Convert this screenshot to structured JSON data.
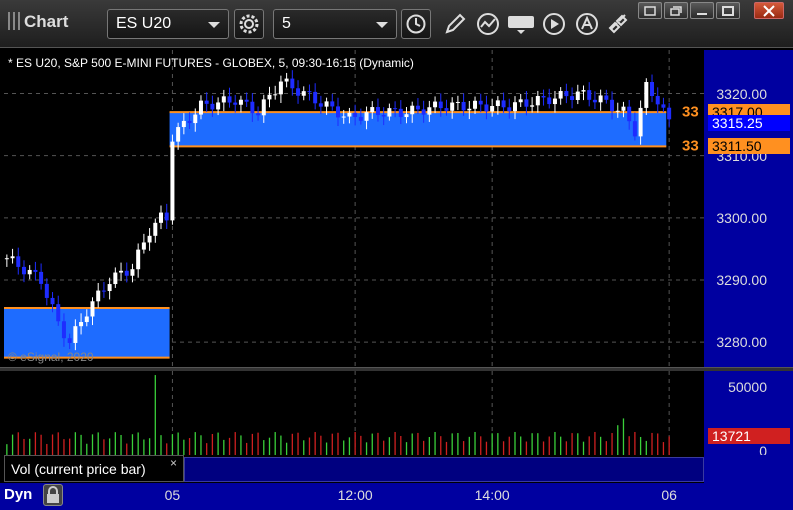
{
  "toolbar": {
    "title": "Chart",
    "symbol": "ES U20",
    "interval": "5"
  },
  "chart": {
    "header": "* ES U20, S&P 500 E-MINI FUTURES - GLOBEX, 5, 09:30-16:15 (Dynamic)",
    "copyright": "© eSignal, 2020",
    "price_ticks": [
      {
        "label": "3320.00",
        "value": 3320
      },
      {
        "label": "3310.00",
        "value": 3310
      },
      {
        "label": "3300.00",
        "value": 3300
      },
      {
        "label": "3290.00",
        "value": 3290
      },
      {
        "label": "3280.00",
        "value": 3280
      }
    ],
    "price_tags": [
      {
        "label": "3317.00",
        "value": 3317,
        "bg": "#ff9020",
        "fg": "#000"
      },
      {
        "label": "3315.25",
        "value": 3315.25,
        "bg": "#0000ff",
        "fg": "#fff"
      },
      {
        "label": "3311.50",
        "value": 3311.5,
        "bg": "#ff9020",
        "fg": "#000"
      }
    ],
    "level_counts": [
      {
        "label": "33",
        "value": 3317
      },
      {
        "label": "33",
        "value": 3311.5
      }
    ],
    "zones": [
      {
        "from_bar": 0,
        "to_bar": 28,
        "low": 3277.5,
        "high": 3285.5
      },
      {
        "from_bar": 29,
        "to_bar": 115,
        "low": 3311.5,
        "high": 3317
      }
    ],
    "ylim": [
      3276,
      3327
    ],
    "volume_ticks": [
      {
        "label": "50000",
        "value": 50000
      },
      {
        "label": "0",
        "value": 0
      }
    ],
    "volume_tag": {
      "label": "13721",
      "value": 13721
    },
    "volume_max": 62000,
    "time_labels": [
      {
        "label": "05",
        "bar": 29
      },
      {
        "label": "12:00",
        "bar": 61
      },
      {
        "label": "14:00",
        "bar": 85
      },
      {
        "label": "06",
        "bar": 116
      }
    ],
    "total_bars": 117
  },
  "volume_panel": {
    "label": "Vol (current price bar)",
    "close_glyph": "×"
  },
  "bottom": {
    "mode": "Dyn"
  },
  "colors": {
    "up": "#ffffff",
    "down": "#1e2cff",
    "zone_fill": "#1e6cff",
    "zone_border": "#ff9020",
    "vol_up": "#3ad03a",
    "vol_down": "#d02020",
    "axis_bg": "#0000a0"
  }
}
